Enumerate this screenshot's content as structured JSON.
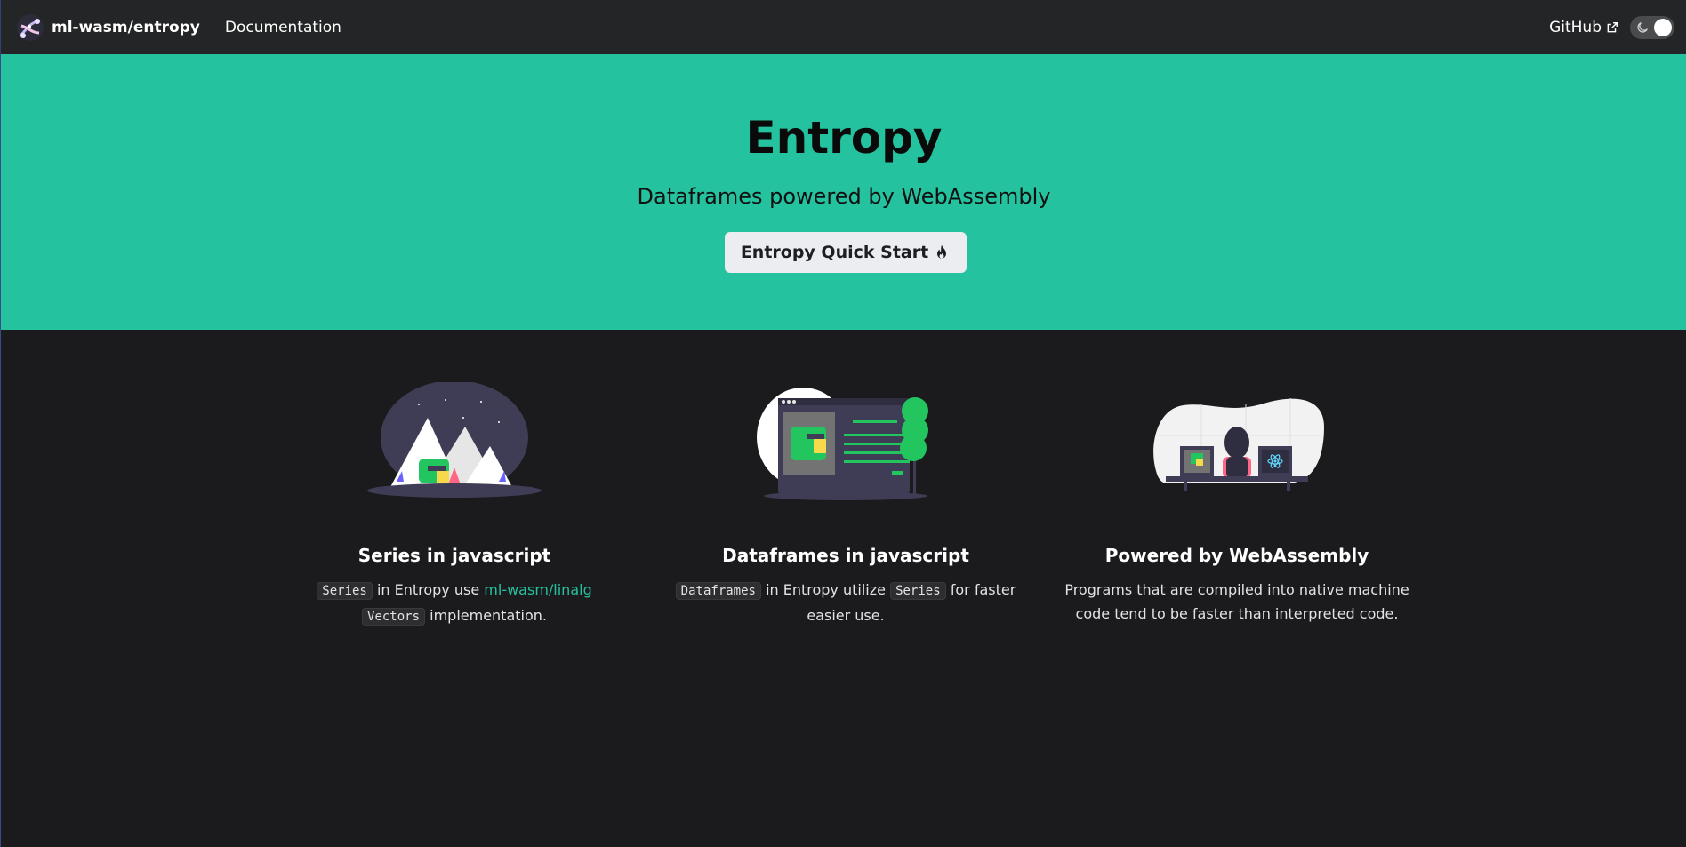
{
  "navbar": {
    "brand_title": "ml-wasm/entropy",
    "logo_icon": "dna-logo-icon",
    "links": [
      {
        "label": "Documentation"
      }
    ],
    "github_label": "GitHub",
    "github_icon": "external-link-icon",
    "theme_toggle": {
      "icon": "moon-icon",
      "state": "dark"
    }
  },
  "hero": {
    "title": "Entropy",
    "subtitle": "Dataframes powered by WebAssembly",
    "button_label": "Entropy Quick Start",
    "button_icon": "fire-icon",
    "background_color": "#25c29f"
  },
  "features": [
    {
      "illustration": "mountains-dinosaur-illustration",
      "title": "Series in javascript",
      "code_1": "Series",
      "text_1": "in Entropy use",
      "link_text": "ml-wasm/linalg",
      "code_2": "Vectors",
      "text_2": "implementation."
    },
    {
      "illustration": "browser-dinosaur-illustration",
      "title": "Dataframes in javascript",
      "code_1": "Dataframes",
      "text_1": "in Entropy utilize",
      "code_2": "Series",
      "text_2": "for faster easier use."
    },
    {
      "illustration": "developer-monitors-illustration",
      "title": "Powered by WebAssembly",
      "text_1": "Programs that are compiled into native machine code tend to be faster than interpreted code."
    }
  ],
  "colors": {
    "navbar_bg": "#242526",
    "page_bg": "#1b1b1d",
    "accent": "#25c29f"
  }
}
